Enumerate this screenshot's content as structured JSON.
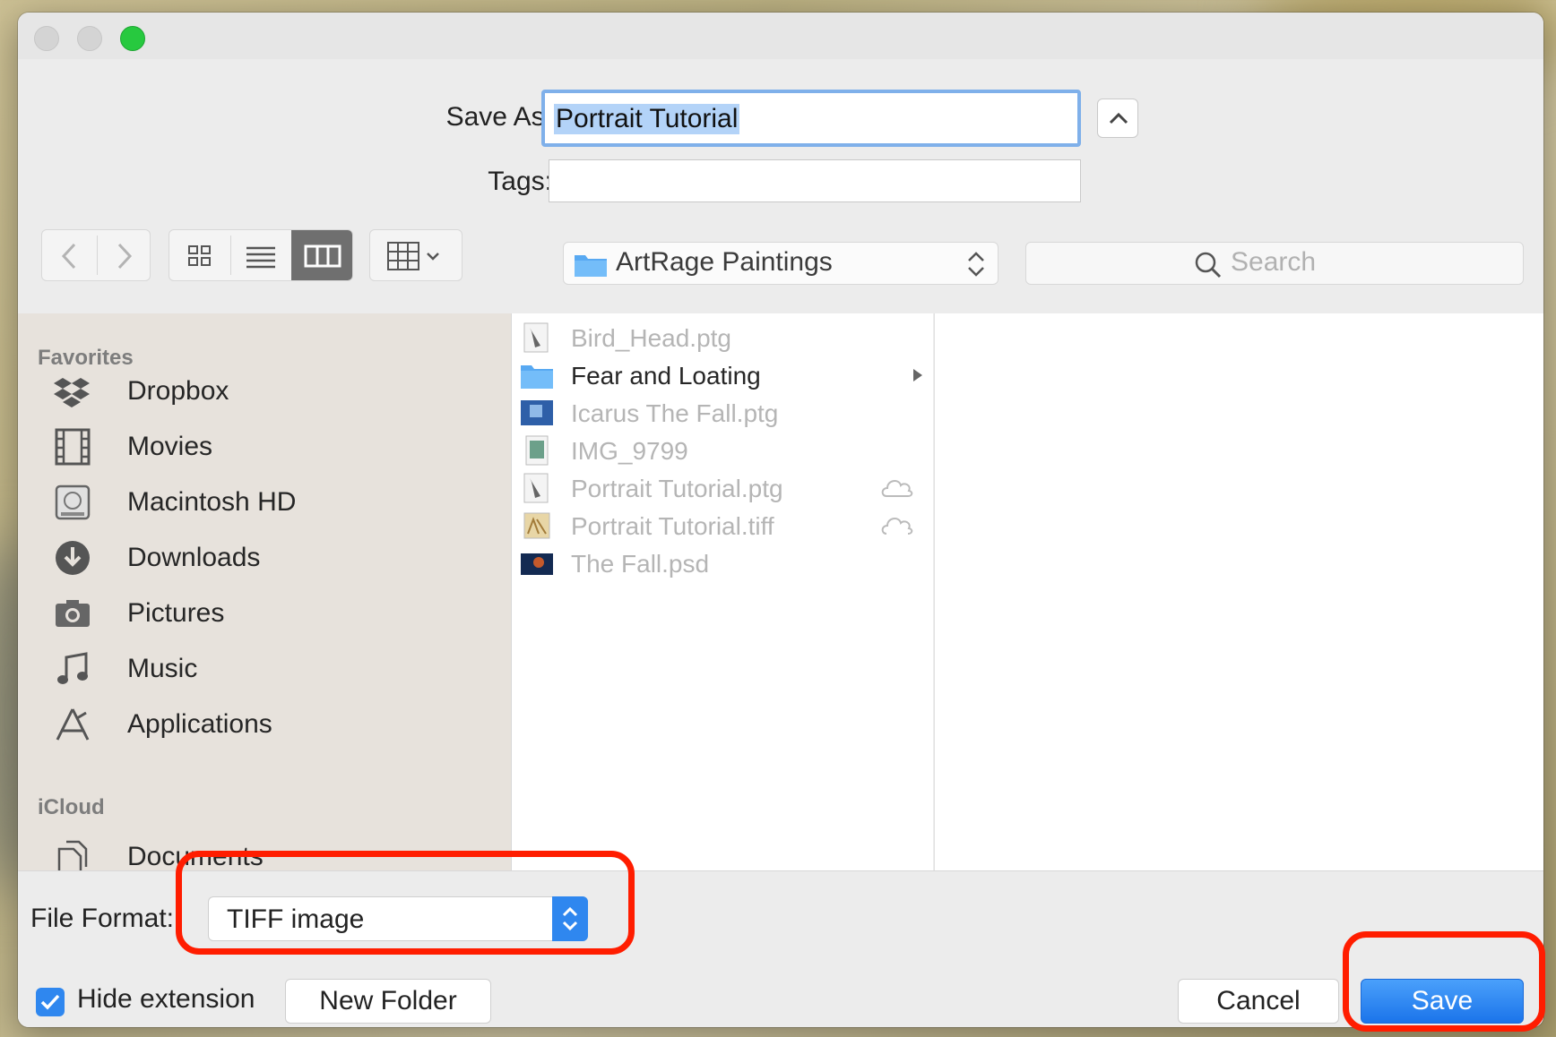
{
  "dialog": {
    "save_as_label": "Save As:",
    "save_as_value": "Portrait Tutorial",
    "tags_label": "Tags:",
    "tags_value": ""
  },
  "toolbar": {
    "location": "ArtRage Paintings",
    "search_placeholder": "Search"
  },
  "sidebar": {
    "favorites_heading": "Favorites",
    "favorites": [
      {
        "label": "Dropbox",
        "icon": "dropbox-icon"
      },
      {
        "label": "Movies",
        "icon": "film-icon"
      },
      {
        "label": "Macintosh HD",
        "icon": "hard-drive-icon"
      },
      {
        "label": "Downloads",
        "icon": "download-icon"
      },
      {
        "label": "Pictures",
        "icon": "camera-icon"
      },
      {
        "label": "Music",
        "icon": "music-note-icon"
      },
      {
        "label": "Applications",
        "icon": "applications-icon"
      }
    ],
    "icloud_heading": "iCloud",
    "icloud": [
      {
        "label": "Documents",
        "icon": "documents-icon"
      }
    ]
  },
  "files": [
    {
      "name": "Bird_Head.ptg",
      "type": "file",
      "icon": "ptg-file-icon"
    },
    {
      "name": "Fear and Loating",
      "type": "folder",
      "icon": "folder-icon"
    },
    {
      "name": "Icarus The Fall.ptg",
      "type": "file",
      "icon": "image-thumbnail-icon"
    },
    {
      "name": "IMG_9799",
      "type": "file",
      "icon": "image-file-icon"
    },
    {
      "name": "Portrait Tutorial.ptg",
      "type": "file",
      "icon": "ptg-file-icon",
      "cloud": true
    },
    {
      "name": "Portrait Tutorial.tiff",
      "type": "file",
      "icon": "tiff-file-icon",
      "cloud": true
    },
    {
      "name": "The Fall.psd",
      "type": "file",
      "icon": "psd-thumbnail-icon"
    }
  ],
  "bottom": {
    "file_format_label": "File Format:",
    "file_format_value": "TIFF image",
    "hide_extension_label": "Hide extension",
    "hide_extension_checked": true,
    "new_folder_label": "New Folder",
    "cancel_label": "Cancel",
    "save_label": "Save"
  },
  "colors": {
    "accent": "#2f87ef",
    "highlight": "#ff1d00"
  }
}
